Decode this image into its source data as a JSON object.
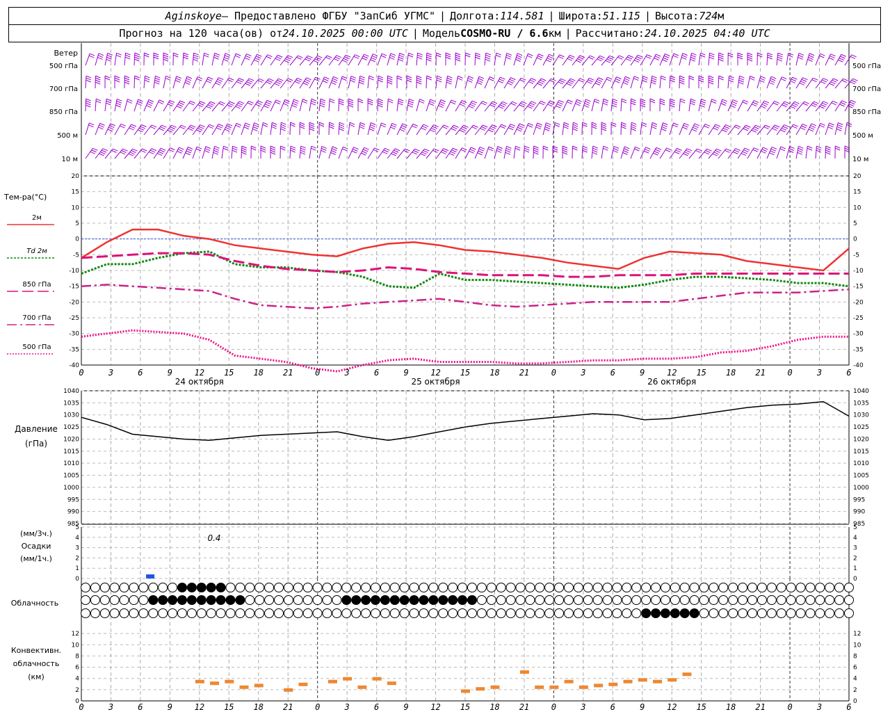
{
  "header": {
    "station": "Aginskoye",
    "provider": " – Предоставлено ФГБУ \"ЗапСиб УГМС\"",
    "lon_label": "Долгота: ",
    "lon": "114.581",
    "lat_label": "Широта: ",
    "lat": "51.115",
    "alt_label": "Высота: ",
    "alt": "724",
    "alt_unit": "м",
    "forecast_label": "Прогноз на 120 часа(ов) от ",
    "forecast_time": "24.10.2025 00:00 UTC",
    "model_label": "Модель ",
    "model": "COSMO-RU / 6.6",
    "model_unit": "км",
    "calc_label": "Рассчитано: ",
    "calc_time": "24.10.2025 04:40 UTC"
  },
  "x_ticks": [
    "0",
    "3",
    "6",
    "9",
    "12",
    "15",
    "18",
    "21",
    "0",
    "3",
    "6",
    "9",
    "12",
    "15",
    "18",
    "21",
    "0",
    "3",
    "6",
    "9",
    "12",
    "15",
    "18",
    "21",
    "0",
    "3",
    "6"
  ],
  "day_labels": [
    "24 октября",
    "25 октября",
    "26 октября"
  ],
  "wind_panel": {
    "title": "Ветер",
    "levels": [
      "500 гПа",
      "700 гПа",
      "850 гПа",
      "500 м",
      "10 м"
    ],
    "barb_color": "#9900cc"
  },
  "chart_data": [
    {
      "type": "line",
      "title": "Тем-ра(°С)",
      "x": [
        0,
        6,
        12,
        18,
        24,
        30,
        36,
        42,
        48,
        54,
        60,
        66,
        72,
        78,
        84,
        90,
        96,
        102,
        108,
        114,
        120,
        126,
        132,
        138,
        144,
        150,
        156
      ],
      "ylim": [
        -40,
        20
      ],
      "y_ticks": [
        20,
        15,
        10,
        5,
        0,
        -5,
        -10,
        -15,
        -20,
        -25,
        -30,
        -35,
        -40
      ],
      "series": [
        {
          "name": "2м",
          "color": "#ee3333",
          "style": "solid",
          "values": [
            -6,
            -1,
            3,
            3,
            1,
            0,
            -2,
            -3,
            -4,
            -5,
            -5.5,
            -3,
            -1.5,
            -1,
            -2,
            -3.5,
            -4,
            -5,
            -6,
            -7.5,
            -8.5,
            -9.5,
            -6,
            -4,
            -4.5,
            -5,
            -7,
            -8,
            -9,
            -10,
            -3
          ]
        },
        {
          "name": "Td 2м",
          "color": "#118811",
          "style": "dot",
          "values": [
            -11,
            -8,
            -8,
            -6,
            -4.5,
            -4,
            -8,
            -9,
            -9,
            -10,
            -10.5,
            -12,
            -15,
            -15.5,
            -11,
            -13,
            -13,
            -13.5,
            -14,
            -14.5,
            -15,
            -15.5,
            -14.5,
            -13,
            -12,
            -12,
            -12.5,
            -13,
            -14,
            -14,
            -15
          ]
        },
        {
          "name": "850 гПа",
          "color": "#dd1177",
          "style": "dash",
          "values": [
            -6,
            -5.5,
            -5,
            -4.5,
            -4.5,
            -5,
            -7,
            -8.5,
            -9.5,
            -10,
            -10.5,
            -10,
            -9,
            -9.5,
            -10.5,
            -11,
            -11.5,
            -11.5,
            -11.5,
            -12,
            -12,
            -11.5,
            -11.5,
            -11.5,
            -11,
            -11,
            -11,
            -11,
            -11,
            -11,
            -11
          ]
        },
        {
          "name": "700 гПа",
          "color": "#cc2288",
          "style": "dashdot",
          "values": [
            -15,
            -14.5,
            -15,
            -15.5,
            -16,
            -16.5,
            -19,
            -21,
            -21.5,
            -22,
            -21.5,
            -20.5,
            -20,
            -19.5,
            -19,
            -20,
            -21,
            -21.5,
            -21,
            -20.5,
            -20,
            -20,
            -20,
            -20,
            -19,
            -18,
            -17,
            -17,
            -17,
            -16.5,
            -16
          ]
        },
        {
          "name": "500 гПа",
          "color": "#ee1188",
          "style": "dotdense",
          "values": [
            -31,
            -30,
            -29,
            -29.5,
            -30,
            -32,
            -37,
            -38,
            -39,
            -41,
            -42,
            -40,
            -38.5,
            -38,
            -39,
            -39,
            -39,
            -39.5,
            -39.5,
            -39,
            -38.5,
            -38.5,
            -38,
            -38,
            -37.5,
            -36,
            -35.5,
            -34,
            -32,
            -31,
            -31
          ]
        }
      ]
    },
    {
      "type": "line",
      "title": "Давление",
      "unit": "(гПа)",
      "ylim": [
        985,
        1040
      ],
      "y_ticks": [
        1040,
        1035,
        1030,
        1025,
        1020,
        1015,
        1010,
        1005,
        1000,
        995,
        990,
        985
      ],
      "series": [
        {
          "color": "#000000",
          "values": [
            1029,
            1026,
            1022,
            1021,
            1020,
            1019.5,
            1020.5,
            1021.5,
            1022,
            1022.5,
            1023,
            1021,
            1019.5,
            1021,
            1023,
            1025,
            1026.5,
            1027.5,
            1028.5,
            1029.5,
            1030.5,
            1030,
            1028,
            1028.5,
            1030,
            1031.5,
            1033,
            1034,
            1034.5,
            1035.5,
            1029.5
          ]
        }
      ]
    },
    {
      "type": "bar",
      "title": "Осадки",
      "unit_top": "(мм/3ч.)",
      "unit_bottom": "(мм/1ч.)",
      "ylim": [
        0,
        5
      ],
      "y_ticks": [
        "5",
        "4",
        "3",
        "2",
        "1",
        "0"
      ],
      "annotation": "0.4",
      "bars": [
        {
          "x": 14,
          "value": 0.4,
          "color": "#2255dd"
        }
      ]
    },
    {
      "type": "bar",
      "title": "Конвективн. облачность",
      "unit": "(км)",
      "ylim": [
        0,
        14
      ],
      "y_ticks": [
        "12",
        "10",
        "8",
        "6",
        "4",
        "2",
        "0"
      ],
      "bar_color": "#ee8833"
    }
  ],
  "cloud_panel": {
    "title": "Облачность"
  }
}
